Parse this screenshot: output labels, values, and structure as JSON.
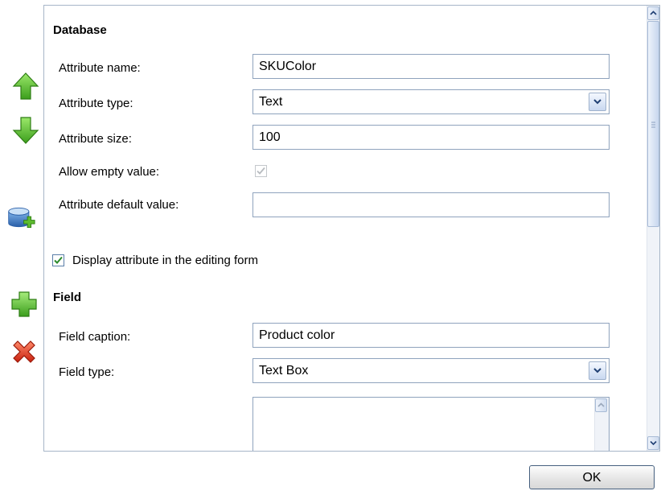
{
  "database": {
    "title": "Database",
    "attribute_name_label": "Attribute name:",
    "attribute_name_value": "SKUColor",
    "attribute_type_label": "Attribute type:",
    "attribute_type_value": "Text",
    "attribute_size_label": "Attribute size:",
    "attribute_size_value": "100",
    "allow_empty_label": "Allow empty value:",
    "allow_empty_checked": true,
    "default_value_label": "Attribute default value:",
    "default_value_value": ""
  },
  "display_in_form": {
    "label": "Display attribute in the editing form",
    "checked": true
  },
  "field": {
    "title": "Field",
    "caption_label": "Field caption:",
    "caption_value": "Product color",
    "type_label": "Field type:",
    "type_value": "Text Box"
  },
  "ok_label": "OK",
  "toolbar": [
    "arrow-up-icon",
    "arrow-down-icon",
    "add-database-icon",
    "add-icon",
    "delete-icon"
  ],
  "colors": {
    "border": "#a7b6c8",
    "green": "#5dbb2e",
    "red": "#d8301c",
    "check": "#2b8a2b"
  }
}
